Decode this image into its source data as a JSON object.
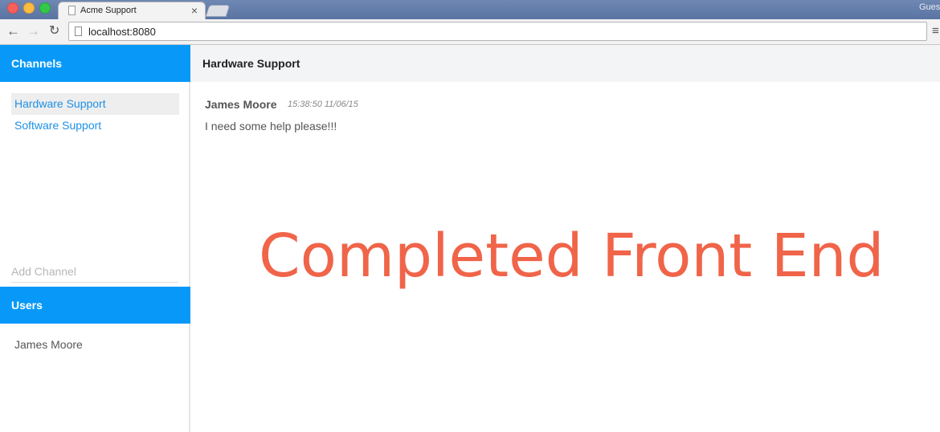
{
  "browser": {
    "tab_title": "Acme Support",
    "tab_close": "×",
    "profile_label": "Guest",
    "url": "localhost:8080",
    "nav": {
      "back": "←",
      "forward": "→",
      "reload": "↻",
      "menu": "≡"
    }
  },
  "sidebar": {
    "channels_header": "Channels",
    "channels": [
      {
        "label": "Hardware Support",
        "active": true
      },
      {
        "label": "Software Support",
        "active": false
      }
    ],
    "add_channel_placeholder": "Add Channel",
    "users_header": "Users",
    "users": [
      {
        "name": "James Moore"
      }
    ]
  },
  "main": {
    "channel_title": "Hardware Support",
    "messages": [
      {
        "author": "James Moore",
        "timestamp": "15:38:50 11/06/15",
        "text": "I need some help please!!!"
      }
    ]
  },
  "overlay": {
    "text": "Completed Front End"
  },
  "colors": {
    "header_blue": "#0899f8",
    "link_blue": "#1e90e6",
    "overlay_orange": "#f06449"
  }
}
